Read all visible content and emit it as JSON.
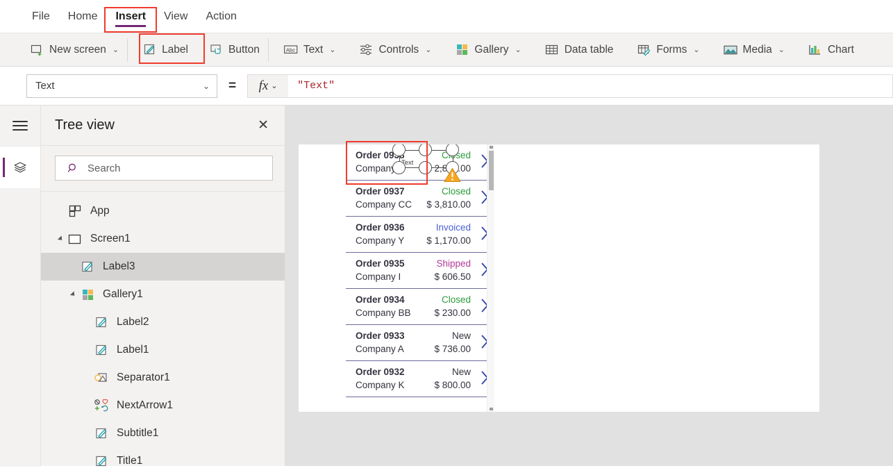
{
  "menubar": {
    "items": [
      {
        "label": "File",
        "active": false
      },
      {
        "label": "Home",
        "active": false
      },
      {
        "label": "Insert",
        "active": true
      },
      {
        "label": "View",
        "active": false
      },
      {
        "label": "Action",
        "active": false
      }
    ]
  },
  "ribbon": {
    "items": [
      {
        "label": "New screen",
        "icon": "new-screen-icon",
        "caret": "⌄",
        "highlighted": false
      },
      {
        "label": "Label",
        "icon": "label-icon",
        "caret": "",
        "highlighted": true
      },
      {
        "label": "Button",
        "icon": "button-icon",
        "caret": "",
        "highlighted": false
      },
      {
        "label": "Text",
        "icon": "text-abc-icon",
        "caret": "⌄",
        "highlighted": false
      },
      {
        "label": "Controls",
        "icon": "controls-sliders-icon",
        "caret": "⌄",
        "highlighted": false
      },
      {
        "label": "Gallery",
        "icon": "gallery-grid-icon",
        "caret": "⌄",
        "highlighted": false
      },
      {
        "label": "Data table",
        "icon": "data-table-icon",
        "caret": "",
        "highlighted": false
      },
      {
        "label": "Forms",
        "icon": "forms-icon",
        "caret": "⌄",
        "highlighted": false
      },
      {
        "label": "Media",
        "icon": "media-image-icon",
        "caret": "⌄",
        "highlighted": false
      },
      {
        "label": "Chart",
        "icon": "chart-bars-icon",
        "caret": "⌄",
        "highlighted": false
      }
    ]
  },
  "formulabar": {
    "property": "Text",
    "property_caret": "⌄",
    "equals": "=",
    "fx_label": "fx",
    "fx_caret": "⌄",
    "formula": "\"Text\""
  },
  "treepanel": {
    "title": "Tree view",
    "close_label": "✕",
    "search_placeholder": "Search",
    "search_value": "",
    "items": [
      {
        "label": "App",
        "icon": "app-icon",
        "indent": 0,
        "twisty": "none",
        "selected": false
      },
      {
        "label": "Screen1",
        "icon": "screen-icon",
        "indent": 0,
        "twisty": "expanded",
        "selected": false
      },
      {
        "label": "Label3",
        "icon": "label-edit-icon",
        "indent": 1,
        "twisty": "none",
        "selected": true
      },
      {
        "label": "Gallery1",
        "icon": "gallery-grid-icon",
        "indent": 1,
        "twisty": "expanded",
        "selected": false
      },
      {
        "label": "Label2",
        "icon": "label-edit-icon",
        "indent": 2,
        "twisty": "none",
        "selected": false
      },
      {
        "label": "Label1",
        "icon": "label-edit-icon",
        "indent": 2,
        "twisty": "none",
        "selected": false
      },
      {
        "label": "Separator1",
        "icon": "separator-shape-icon",
        "indent": 2,
        "twisty": "none",
        "selected": false
      },
      {
        "label": "NextArrow1",
        "icon": "next-arrow-icons",
        "indent": 2,
        "twisty": "none",
        "selected": false
      },
      {
        "label": "Subtitle1",
        "icon": "label-edit-icon",
        "indent": 2,
        "twisty": "none",
        "selected": false
      },
      {
        "label": "Title1",
        "icon": "label-edit-icon",
        "indent": 2,
        "twisty": "none",
        "selected": false
      }
    ]
  },
  "canvas": {
    "selected_control": {
      "name": "Label3",
      "text": "Text",
      "warning_icon": "warning-triangle-icon"
    },
    "gallery": {
      "items": [
        {
          "title": "Order 0938",
          "status": "Closed",
          "status_color": "#2c9c3a",
          "company": "Company F",
          "amount": "$ 2,870.00"
        },
        {
          "title": "Order 0937",
          "status": "Closed",
          "status_color": "#2c9c3a",
          "company": "Company CC",
          "amount": "$ 3,810.00"
        },
        {
          "title": "Order 0936",
          "status": "Invoiced",
          "status_color": "#4a5fd0",
          "company": "Company Y",
          "amount": "$ 1,170.00"
        },
        {
          "title": "Order 0935",
          "status": "Shipped",
          "status_color": "#b4399a",
          "company": "Company I",
          "amount": "$ 606.50"
        },
        {
          "title": "Order 0934",
          "status": "Closed",
          "status_color": "#2c9c3a",
          "company": "Company BB",
          "amount": "$ 230.00"
        },
        {
          "title": "Order 0933",
          "status": "New",
          "status_color": "#32323e",
          "company": "Company A",
          "amount": "$ 736.00"
        },
        {
          "title": "Order 0932",
          "status": "New",
          "status_color": "#32323e",
          "company": "Company K",
          "amount": "$ 800.00"
        }
      ],
      "chevron_icon": "chevron-right-icon"
    }
  },
  "colors": {
    "accent": "#742774",
    "highlight_outline": "#f03a2e",
    "chevron": "#3b4ba8",
    "ribbon_bg": "#f3f2f1",
    "canvas_bg": "#e1e1e1"
  }
}
